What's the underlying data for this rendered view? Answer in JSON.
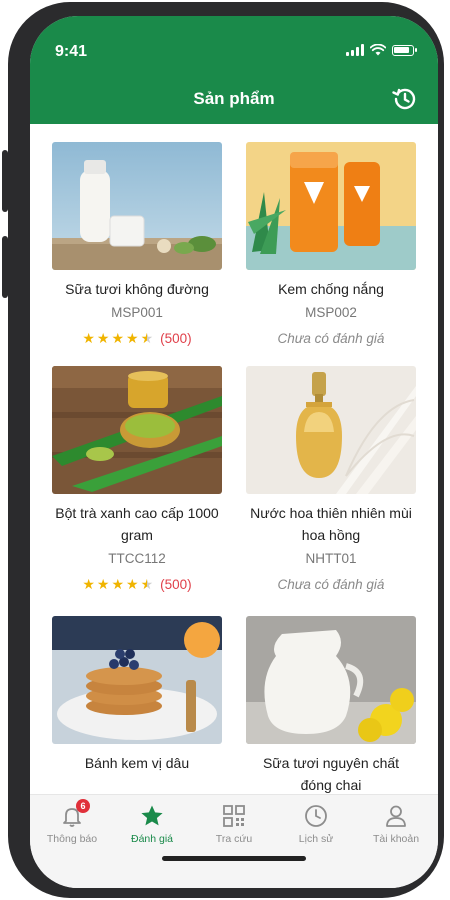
{
  "status_bar": {
    "time": "9:41"
  },
  "header": {
    "title": "Sản phẩm",
    "history_icon": "history-icon"
  },
  "products": [
    {
      "name": "Sữa tươi không đường",
      "code": "MSP001",
      "rating": 4.5,
      "rating_count": "(500)",
      "no_rating_text": ""
    },
    {
      "name": "Kem chống nắng",
      "code": "MSP002",
      "rating": 0,
      "rating_count": "",
      "no_rating_text": "Chưa có đánh giá"
    },
    {
      "name": "Bột trà xanh cao cấp 1000 gram",
      "code": "TTCC112",
      "rating": 4.5,
      "rating_count": "(500)",
      "no_rating_text": ""
    },
    {
      "name": "Nước hoa thiên nhiên mùi hoa hồng",
      "code": "NHTT01",
      "rating": 0,
      "rating_count": "",
      "no_rating_text": "Chưa có đánh giá"
    },
    {
      "name": "Bánh kem vị dâu",
      "code": "",
      "rating": 0,
      "rating_count": "",
      "no_rating_text": ""
    },
    {
      "name": "Sữa tươi nguyên chất đóng chai",
      "code": "",
      "rating": 0,
      "rating_count": "",
      "no_rating_text": ""
    }
  ],
  "bottom_nav": [
    {
      "label": "Thông báo",
      "icon": "bell-icon",
      "badge": "6",
      "active": false
    },
    {
      "label": "Đánh giá",
      "icon": "star-icon",
      "badge": "",
      "active": true
    },
    {
      "label": "Tra cứu",
      "icon": "qr-icon",
      "badge": "",
      "active": false
    },
    {
      "label": "Lịch sử",
      "icon": "clock-icon",
      "badge": "",
      "active": false
    },
    {
      "label": "Tài khoản",
      "icon": "user-icon",
      "badge": "",
      "active": false
    }
  ],
  "colors": {
    "brand": "#1a8a4a",
    "star": "#f0b400",
    "rating_count": "#e0404a",
    "badge": "#e0303a"
  }
}
